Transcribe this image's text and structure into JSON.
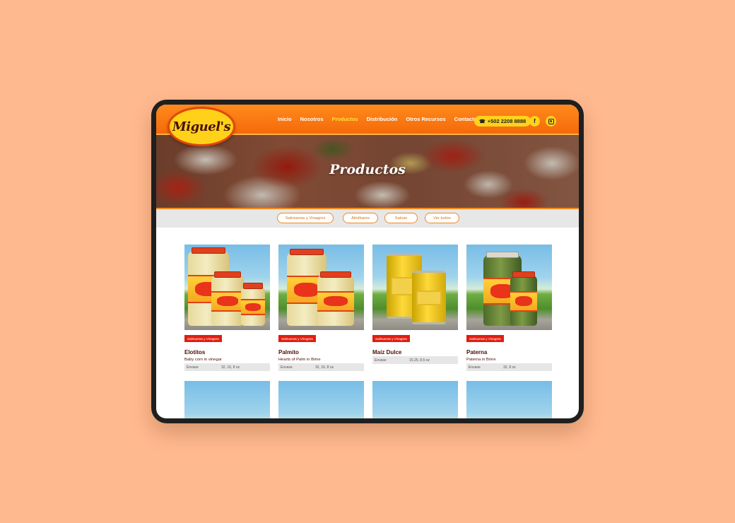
{
  "header": {
    "logo_text": "Miguel's",
    "nav": [
      "Inicio",
      "Nosotros",
      "Productos",
      "Distribución",
      "Otros Recursos",
      "Contacto"
    ],
    "active_nav": "Productos",
    "phone": "+502 2208 8888",
    "facebook": "f"
  },
  "hero": {
    "title": "Productos"
  },
  "filters": [
    "Salmueras y Vinagres",
    "Almíbares",
    "Salsas",
    "Ver todos"
  ],
  "products": [
    {
      "category": "Salmueras y Vinagres",
      "name": "Elotitos",
      "desc": "Baby corn in vinegar",
      "spec_label": "Envase",
      "spec_value": "32, 16, 8 oz"
    },
    {
      "category": "Salmueras y Vinagres",
      "name": "Palmito",
      "desc": "Hearts of Palm in Brine",
      "spec_label": "Envase",
      "spec_value": "32, 16, 8 oz"
    },
    {
      "category": "Salmueras y Vinagres",
      "name": "Maíz Dulce",
      "desc": "",
      "spec_label": "Envase",
      "spec_value": "15.25, 8.5 oz"
    },
    {
      "category": "Salmueras y Vinagres",
      "name": "Paterna",
      "desc": "Paterna in Brine",
      "spec_label": "Envase",
      "spec_value": "32, 8 oz"
    }
  ],
  "colors": {
    "header_orange": "#f46a0a",
    "accent_yellow": "#ffd21c",
    "badge_red": "#e21d10",
    "product_name": "#4a0f08",
    "page_bg": "#ffb98f"
  },
  "icons": [
    "phone-icon",
    "facebook-icon",
    "instagram-icon"
  ]
}
